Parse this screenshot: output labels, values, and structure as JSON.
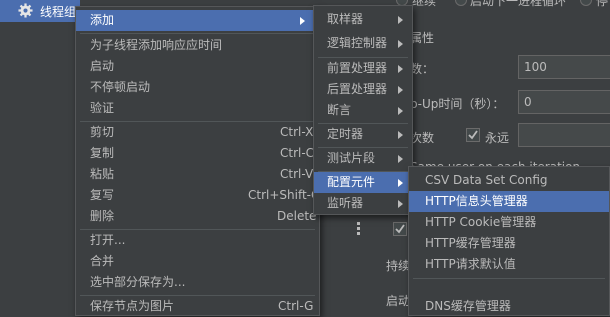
{
  "tree": {
    "label": "线程组"
  },
  "background": {
    "radio_options": [
      "继续",
      "启动下一进程循环",
      "停"
    ],
    "section_title": "属性",
    "fields": [
      {
        "label": "数：",
        "value": "100"
      },
      {
        "label": "p-Up时间（秒）：",
        "value": "0"
      }
    ],
    "loop_label": "次数",
    "forever_label": "永远",
    "same_user_text": "Same user on each iteration",
    "continue_label": "持续",
    "start_label": "启动"
  },
  "context_menu": {
    "items": [
      {
        "label": "添加",
        "shortcut": "",
        "submenu": true,
        "selected": true
      },
      {
        "label": "为子线程添加响应应时间",
        "shortcut": ""
      },
      {
        "label": "启动",
        "shortcut": ""
      },
      {
        "label": "不停顿启动",
        "shortcut": ""
      },
      {
        "label": "验证",
        "shortcut": ""
      },
      {
        "label": "剪切",
        "shortcut": "Ctrl-X"
      },
      {
        "label": "复制",
        "shortcut": "Ctrl-C"
      },
      {
        "label": "粘贴",
        "shortcut": "Ctrl-V"
      },
      {
        "label": "复写",
        "shortcut": "Ctrl+Shift-C"
      },
      {
        "label": "删除",
        "shortcut": "Delete"
      },
      {
        "label": "打开...",
        "shortcut": ""
      },
      {
        "label": "合并",
        "shortcut": ""
      },
      {
        "label": "选中部分保存为...",
        "shortcut": ""
      },
      {
        "label": "保存节点为图片",
        "shortcut": "Ctrl-G"
      }
    ]
  },
  "add_submenu": {
    "items": [
      {
        "label": "取样器"
      },
      {
        "label": "逻辑控制器"
      },
      {
        "label": "前置处理器"
      },
      {
        "label": "后置处理器"
      },
      {
        "label": "断言"
      },
      {
        "label": "定时器"
      },
      {
        "label": "测试片段"
      },
      {
        "label": "配置元件",
        "selected": true
      },
      {
        "label": "监听器"
      }
    ]
  },
  "config_submenu": {
    "items": [
      {
        "label": "CSV Data Set Config"
      },
      {
        "label": "HTTP信息头管理器",
        "selected": true
      },
      {
        "label": "HTTP Cookie管理器"
      },
      {
        "label": "HTTP缓存管理器"
      },
      {
        "label": "HTTP请求默认值"
      },
      {
        "label": "DNS缓存管理器"
      }
    ]
  },
  "colors": {
    "background": "#3c3f41",
    "selection": "#4b6eaf",
    "text": "#bbbbbb",
    "border": "#555759"
  }
}
